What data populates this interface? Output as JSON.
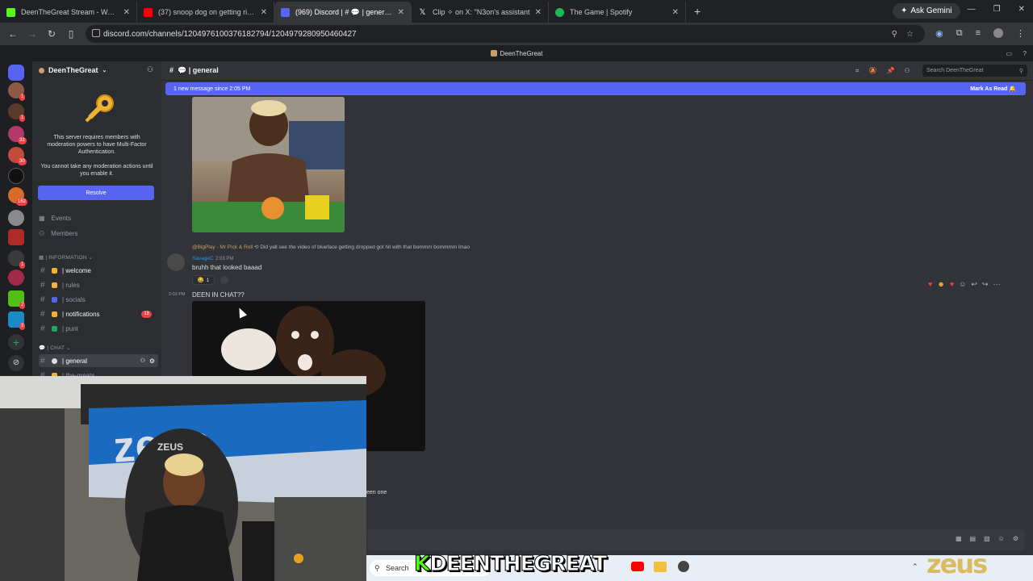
{
  "browser": {
    "tabs": [
      {
        "label": "DeenTheGreat Stream - Watch",
        "color": "#53fc18"
      },
      {
        "label": "(37) snoop dog on getting rid o",
        "color": "#ff0000"
      },
      {
        "label": "(969) Discord | # 💬 | general |",
        "color": "#5865f2"
      },
      {
        "label": "Clip ✧ on X: \"N3on's assistant",
        "color": "#ffffff"
      },
      {
        "label": "The Game | Spotify",
        "color": "#1db954"
      }
    ],
    "gemini_label": "Ask Gemini",
    "url": "discord.com/channels/1204976100376182794/1204979280950460427"
  },
  "discord": {
    "title": "DeenTheGreat",
    "server_name": "DeenTheGreat",
    "mfa_notice": "This server requires members with moderation powers to have Multi-Factor Authentication.",
    "mfa_sub": "You cannot take any moderation actions until you enable it.",
    "resolve_label": "Resolve",
    "events_label": "Events",
    "members_label": "Members",
    "categories": {
      "information": "INFORMATION",
      "chat": "CHAT"
    },
    "info_channels": [
      {
        "name": "welcome",
        "color": "#f0b232"
      },
      {
        "name": "rules",
        "color": "#f0b232"
      },
      {
        "name": "socials",
        "color": "#5865f2"
      },
      {
        "name": "notifications",
        "color": "#f0b232",
        "badge": "18"
      },
      {
        "name": "punt",
        "color": "#23a55a"
      }
    ],
    "chat_channels": [
      {
        "name": "general"
      },
      {
        "name": "the-greats"
      }
    ],
    "rail_badges": [
      "1",
      "1",
      "32",
      "30",
      "162",
      "1",
      "2",
      "3"
    ],
    "channel_header": "general",
    "search_placeholder": "Search DeenTheGreat",
    "new_messages": "1 new message since 2:05 PM",
    "mark_as_read": "Mark As Read",
    "reply_ref_user": "@BigPlay - Mr Pick & Roll",
    "reply_ref_text": "Did yall see the video of blueface getting dropped got hit with that bommm bommmm lmao",
    "msg1_author": "SavageC",
    "msg1_time": "2:03 PM",
    "msg1_text": "bruhh that looked baaad",
    "reaction_count": "1",
    "msg2_time": "2:03 PM",
    "msg2_text": "DEEN IN CHAT??",
    "partial_text": "een one"
  },
  "overlay": {
    "brand_k": "K",
    "brand_text": "DEENTHEGREAT",
    "zeus_logo": "zeus",
    "cam_banner": "zeus",
    "cam_chair": "ZEUS"
  },
  "taskbar": {
    "search_label": "Search"
  }
}
